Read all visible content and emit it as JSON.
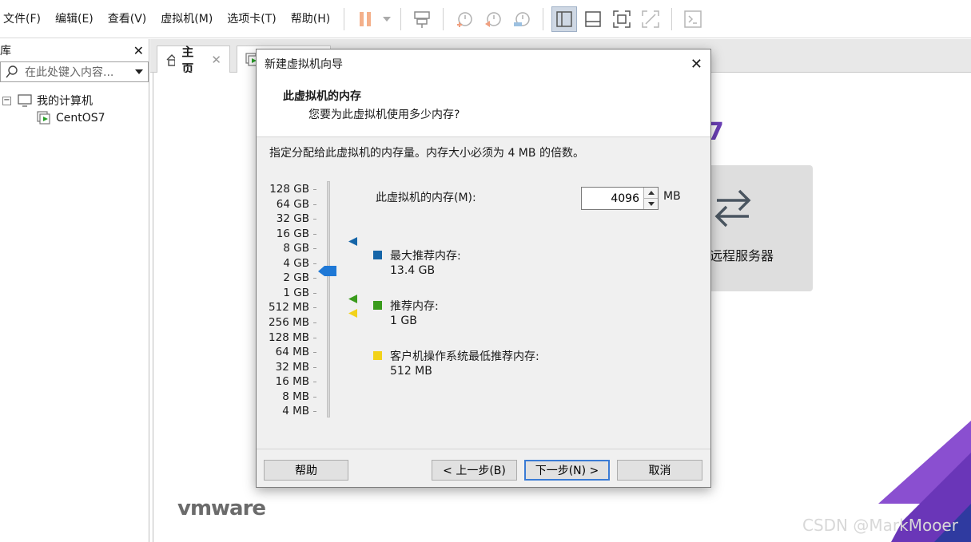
{
  "menu": {
    "items": [
      "文件(F)",
      "编辑(E)",
      "查看(V)",
      "虚拟机(M)",
      "选项卡(T)",
      "帮助(H)"
    ]
  },
  "toolbar": {
    "icons": [
      "pause-icon",
      "dropdown-arrow-icon",
      "send-keys-icon",
      "snapshot-icon",
      "revert-snapshot-icon",
      "snapshot-manager-icon",
      "library-view-icon",
      "thumbnail-bar-icon",
      "fullscreen-icon",
      "unity-icon",
      "console-icon"
    ]
  },
  "library": {
    "title": "库",
    "search_placeholder": "在此处键入内容...",
    "tree": {
      "root": "我的计算机",
      "vm": "CentOS7"
    }
  },
  "tabs": {
    "home_label": "主页"
  },
  "home": {
    "title_fragment": "7",
    "remote_label": "远程服务器",
    "logo_text": "vmware",
    "watermark": "CSDN @MarkMooer"
  },
  "dialog": {
    "title": "新建虚拟机向导",
    "heading": "此虚拟机的内存",
    "subheading": "您要为此虚拟机使用多少内存?",
    "instruction": "指定分配给此虚拟机的内存量。内存大小必须为 4 MB 的倍数。",
    "scale_labels": [
      "128 GB",
      "64 GB",
      "32 GB",
      "16 GB",
      "8 GB",
      "4 GB",
      "2 GB",
      "1 GB",
      "512 MB",
      "256 MB",
      "128 MB",
      "64 MB",
      "32 MB",
      "16 MB",
      "8 MB",
      "4 MB"
    ],
    "memory_label": "此虚拟机的内存(M):",
    "memory_value": "4096",
    "memory_unit": "MB",
    "legend": [
      {
        "label": "最大推荐内存:",
        "value": "13.4 GB",
        "color": "#1565a8"
      },
      {
        "label": "推荐内存:",
        "value": "1 GB",
        "color": "#3a9b1c"
      },
      {
        "label": "客户机操作系统最低推荐内存:",
        "value": "512 MB",
        "color": "#f2d21a"
      }
    ],
    "buttons": {
      "help": "帮助",
      "back": "< 上一步(B)",
      "next": "下一步(N) >",
      "cancel": "取消"
    }
  },
  "colors": {
    "accent": "#3a7bd5",
    "slider_thumb": "#1e78d6",
    "purple": "#6a3fb5"
  }
}
